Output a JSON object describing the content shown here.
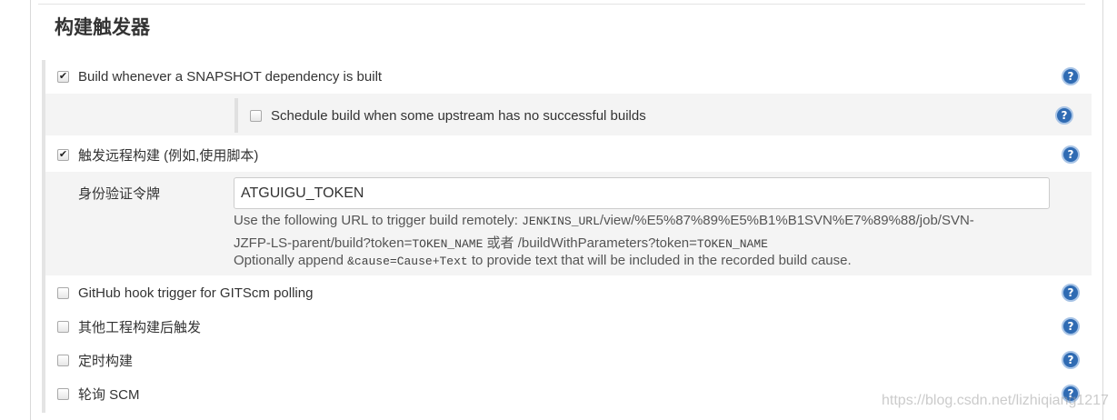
{
  "section": {
    "title": "构建触发器"
  },
  "triggers": {
    "snapshot": {
      "label": "Build whenever a SNAPSHOT dependency is built",
      "checked": true
    },
    "upstream": {
      "label": "Schedule build when some upstream has no successful builds",
      "checked": false
    },
    "remote": {
      "label": "触发远程构建 (例如,使用脚本)",
      "checked": true
    },
    "github": {
      "label": "GitHub hook trigger for GITScm polling",
      "checked": false
    },
    "after_other": {
      "label": "其他工程构建后触发",
      "checked": false
    },
    "periodic": {
      "label": "定时构建",
      "checked": false
    },
    "poll_scm": {
      "label": "轮询 SCM",
      "checked": false
    }
  },
  "remote_config": {
    "token_label": "身份验证令牌",
    "token_value": "ATGUIGU_TOKEN",
    "desc_prefix": "Use the following URL to trigger build remotely: ",
    "url_part1": "JENKINS_URL",
    "url_part2": "/view/%E5%87%89%E5%B1%B1SVN%E7%89%88/job/SVN-",
    "url_part3": "JZFP-LS-parent/build?token=",
    "token_name_1": "TOKEN_NAME",
    "or_text": " 或者 ",
    "url_part4": "/buildWithParameters?token=",
    "token_name_2": "TOKEN_NAME",
    "append_prefix": "Optionally append ",
    "cause_code": "&cause=Cause+Text",
    "append_suffix": " to provide text that will be included in the recorded build cause."
  },
  "help_icon": {
    "glyph": "?",
    "icon_name": "help-icon",
    "color": "#2f6bb3"
  },
  "checkmark_glyph": "✔",
  "watermark": "https://blog.csdn.net/lizhiqiang1217"
}
